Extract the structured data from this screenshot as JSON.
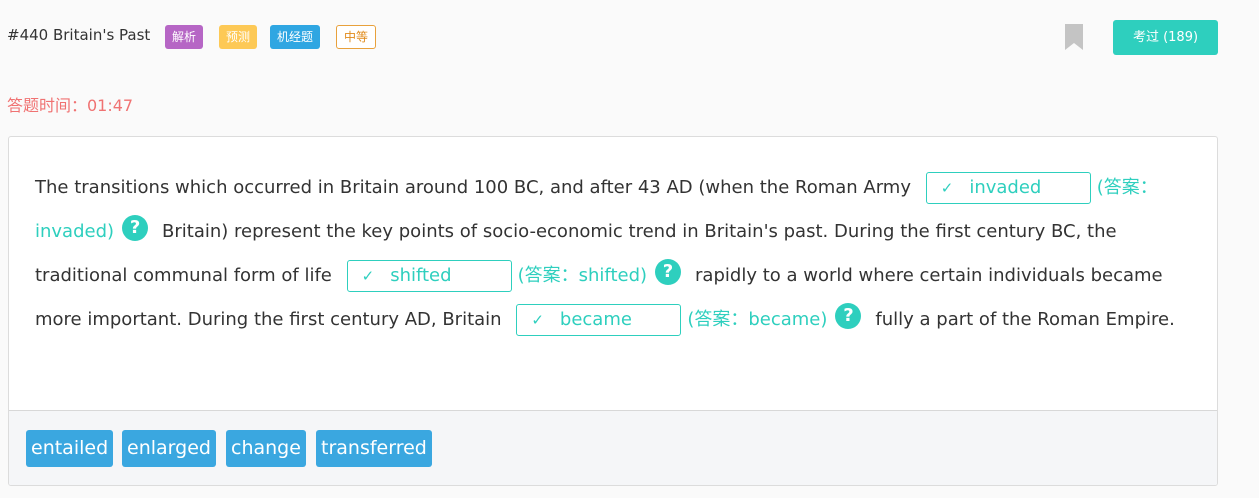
{
  "header": {
    "title": "#440 Britain's Past",
    "tags": [
      "解析",
      "预测",
      "机经题",
      "中等"
    ],
    "exam_button": "考过 (189)"
  },
  "timer": "答题时间：01:47",
  "passage": {
    "segments": [
      "The transitions which occurred in Britain around 100 BC, and after 43 AD (when the Roman Army",
      "Britain) represent the key points of socio-economic trend in Britain's past. During the first century BC, the traditional communal form of life",
      "rapidly to a world where certain individuals became more important. During the first century AD, Britain",
      "fully a part of the Roman Empire."
    ],
    "blanks": [
      {
        "value": "invaded",
        "answer": "(答案：invaded)"
      },
      {
        "value": "shifted",
        "answer": "(答案：shifted)"
      },
      {
        "value": "became",
        "answer": "(答案：became)"
      }
    ]
  },
  "word_bank": [
    "entailed",
    "enlarged",
    "change",
    "transferred"
  ],
  "icons": {
    "check": "check-icon",
    "help": "question-circle-icon",
    "bookmark": "bookmark-icon"
  },
  "colors": {
    "accent": "#2ecfbe",
    "timer": "#f07272",
    "chip": "#3aa7e0",
    "tag_purple": "#b666c5",
    "tag_yellow": "#fdc956",
    "tag_blue": "#2fa6e2",
    "tag_outline": "#e08b1b"
  }
}
